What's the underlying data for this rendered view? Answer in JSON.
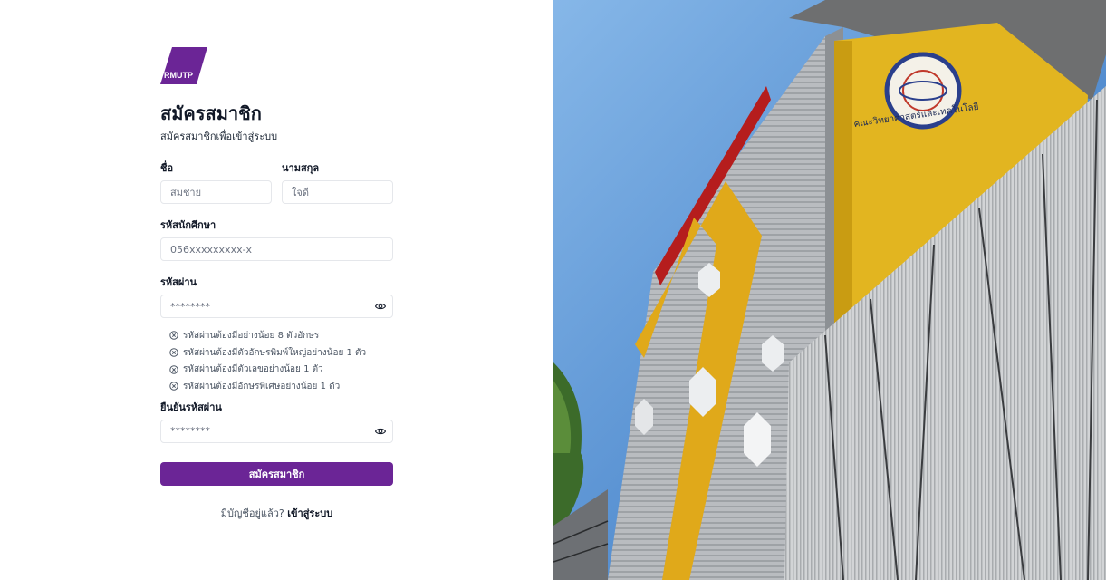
{
  "brand": {
    "logo_text": "RMUTP",
    "color": "#6b2596"
  },
  "page": {
    "title": "สมัครสมาชิก",
    "subtitle": "สมัครสมาชิกเพื่อเข้าสู่ระบบ"
  },
  "form": {
    "first_name": {
      "label": "ชื่อ",
      "placeholder": "สมชาย"
    },
    "last_name": {
      "label": "นามสกุล",
      "placeholder": "ใจดี"
    },
    "student_id": {
      "label": "รหัสนักศึกษา",
      "placeholder": "056xxxxxxxxx-x"
    },
    "password": {
      "label": "รหัสผ่าน",
      "value": "********",
      "eye_icon": "eye-icon"
    },
    "password_rules": [
      "รหัสผ่านต้องมีอย่างน้อย 8 ตัวอักษร",
      "รหัสผ่านต้องมีตัวอักษรพิมพ์ใหญ่อย่างน้อย 1 ตัว",
      "รหัสผ่านต้องมีตัวเลขอย่างน้อย 1 ตัว",
      "รหัสผ่านต้องมีอักษรพิเศษอย่างน้อย 1 ตัว"
    ],
    "confirm_password": {
      "label": "ยืนยันรหัสผ่าน",
      "value": "********",
      "eye_icon": "eye-icon"
    },
    "submit_label": "สมัครสมาชิก"
  },
  "footer": {
    "prompt": "มีบัญชีอยู่แล้ว?",
    "link": "เข้าสู่ระบบ"
  },
  "building_sign": "คณะวิทยาศาสตร์และเทคโนโลยี"
}
